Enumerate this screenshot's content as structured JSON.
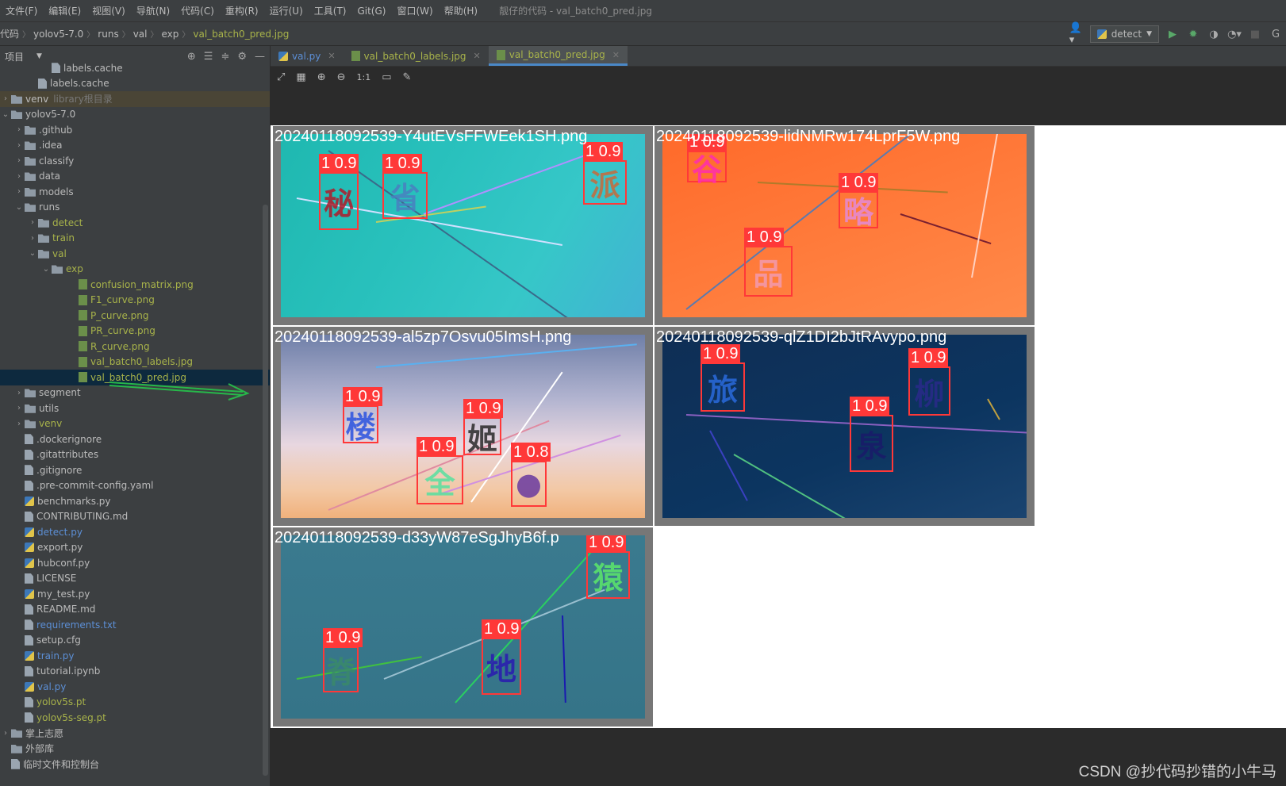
{
  "menu": {
    "items": [
      "文件(F)",
      "编辑(E)",
      "视图(V)",
      "导航(N)",
      "代码(C)",
      "重构(R)",
      "运行(U)",
      "工具(T)",
      "Git(G)",
      "窗口(W)",
      "帮助(H)"
    ],
    "window_title": "靓仔的代码 - val_batch0_pred.jpg"
  },
  "breadcrumb": {
    "root": "代码",
    "parts": [
      "yolov5-7.0",
      "runs",
      "val",
      "exp"
    ],
    "file": "val_batch0_pred.jpg"
  },
  "run_config": {
    "label": "detect"
  },
  "sidebar": {
    "title": "项目",
    "tree": [
      {
        "label": "labels.cache",
        "indent": 3,
        "icon": "file",
        "arrow": "",
        "color": ""
      },
      {
        "label": "labels.cache",
        "indent": 2,
        "icon": "file",
        "arrow": "",
        "color": ""
      },
      {
        "label": "venv",
        "suffix": "library根目录",
        "indent": 0,
        "icon": "folder",
        "arrow": "›",
        "color": "",
        "cls": "venv-root"
      },
      {
        "label": "yolov5-7.0",
        "indent": 0,
        "icon": "folder",
        "arrow": "⌄",
        "color": ""
      },
      {
        "label": ".github",
        "indent": 1,
        "icon": "folder",
        "arrow": "›",
        "color": ""
      },
      {
        "label": ".idea",
        "indent": 1,
        "icon": "folder",
        "arrow": "›",
        "color": ""
      },
      {
        "label": "classify",
        "indent": 1,
        "icon": "folder",
        "arrow": "›",
        "color": ""
      },
      {
        "label": "data",
        "indent": 1,
        "icon": "folder",
        "arrow": "›",
        "color": ""
      },
      {
        "label": "models",
        "indent": 1,
        "icon": "folder",
        "arrow": "›",
        "color": ""
      },
      {
        "label": "runs",
        "indent": 1,
        "icon": "folder",
        "arrow": "⌄",
        "color": ""
      },
      {
        "label": "detect",
        "indent": 2,
        "icon": "folder",
        "arrow": "›",
        "color": "yellow"
      },
      {
        "label": "train",
        "indent": 2,
        "icon": "folder",
        "arrow": "›",
        "color": "yellow"
      },
      {
        "label": "val",
        "indent": 2,
        "icon": "folder",
        "arrow": "⌄",
        "color": "yellow"
      },
      {
        "label": "exp",
        "indent": 3,
        "icon": "folder",
        "arrow": "⌄",
        "color": "yellow"
      },
      {
        "label": "confusion_matrix.png",
        "indent": 5,
        "icon": "img",
        "arrow": "",
        "color": "yellow"
      },
      {
        "label": "F1_curve.png",
        "indent": 5,
        "icon": "img",
        "arrow": "",
        "color": "yellow"
      },
      {
        "label": "P_curve.png",
        "indent": 5,
        "icon": "img",
        "arrow": "",
        "color": "yellow"
      },
      {
        "label": "PR_curve.png",
        "indent": 5,
        "icon": "img",
        "arrow": "",
        "color": "yellow"
      },
      {
        "label": "R_curve.png",
        "indent": 5,
        "icon": "img",
        "arrow": "",
        "color": "yellow"
      },
      {
        "label": "val_batch0_labels.jpg",
        "indent": 5,
        "icon": "img",
        "arrow": "",
        "color": "yellow"
      },
      {
        "label": "val_batch0_pred.jpg",
        "indent": 5,
        "icon": "img",
        "arrow": "",
        "color": "yellow",
        "cls": "sel"
      },
      {
        "label": "segment",
        "indent": 1,
        "icon": "folder",
        "arrow": "›",
        "color": ""
      },
      {
        "label": "utils",
        "indent": 1,
        "icon": "folder",
        "arrow": "›",
        "color": ""
      },
      {
        "label": "venv",
        "indent": 1,
        "icon": "folder",
        "arrow": "›",
        "color": "yellow"
      },
      {
        "label": ".dockerignore",
        "indent": 1,
        "icon": "file",
        "arrow": "",
        "color": ""
      },
      {
        "label": ".gitattributes",
        "indent": 1,
        "icon": "file",
        "arrow": "",
        "color": ""
      },
      {
        "label": ".gitignore",
        "indent": 1,
        "icon": "file",
        "arrow": "",
        "color": ""
      },
      {
        "label": ".pre-commit-config.yaml",
        "indent": 1,
        "icon": "file",
        "arrow": "",
        "color": ""
      },
      {
        "label": "benchmarks.py",
        "indent": 1,
        "icon": "py",
        "arrow": "",
        "color": ""
      },
      {
        "label": "CONTRIBUTING.md",
        "indent": 1,
        "icon": "file",
        "arrow": "",
        "color": ""
      },
      {
        "label": "detect.py",
        "indent": 1,
        "icon": "py",
        "arrow": "",
        "color": "blue"
      },
      {
        "label": "export.py",
        "indent": 1,
        "icon": "py",
        "arrow": "",
        "color": ""
      },
      {
        "label": "hubconf.py",
        "indent": 1,
        "icon": "py",
        "arrow": "",
        "color": ""
      },
      {
        "label": "LICENSE",
        "indent": 1,
        "icon": "file",
        "arrow": "",
        "color": ""
      },
      {
        "label": "my_test.py",
        "indent": 1,
        "icon": "py",
        "arrow": "",
        "color": ""
      },
      {
        "label": "README.md",
        "indent": 1,
        "icon": "file",
        "arrow": "",
        "color": ""
      },
      {
        "label": "requirements.txt",
        "indent": 1,
        "icon": "file",
        "arrow": "",
        "color": "blue"
      },
      {
        "label": "setup.cfg",
        "indent": 1,
        "icon": "file",
        "arrow": "",
        "color": ""
      },
      {
        "label": "train.py",
        "indent": 1,
        "icon": "py",
        "arrow": "",
        "color": "blue"
      },
      {
        "label": "tutorial.ipynb",
        "indent": 1,
        "icon": "file",
        "arrow": "",
        "color": ""
      },
      {
        "label": "val.py",
        "indent": 1,
        "icon": "py",
        "arrow": "",
        "color": "blue"
      },
      {
        "label": "yolov5s.pt",
        "indent": 1,
        "icon": "file",
        "arrow": "",
        "color": "yellow"
      },
      {
        "label": "yolov5s-seg.pt",
        "indent": 1,
        "icon": "file",
        "arrow": "",
        "color": "yellow"
      },
      {
        "label": "掌上志愿",
        "indent": 0,
        "icon": "folder",
        "arrow": "›",
        "color": ""
      },
      {
        "label": "外部库",
        "indent": 0,
        "icon": "folder",
        "arrow": "",
        "color": ""
      },
      {
        "label": "临时文件和控制台",
        "indent": 0,
        "icon": "file",
        "arrow": "",
        "color": ""
      }
    ]
  },
  "tabs": [
    {
      "label": "val.py",
      "kind": "py"
    },
    {
      "label": "val_batch0_labels.jpg",
      "kind": "img"
    },
    {
      "label": "val_batch0_pred.jpg",
      "kind": "img",
      "active": true
    }
  ],
  "image_toolbar": {
    "icons": [
      "fit-icon",
      "grid-icon",
      "zoom-in-icon",
      "zoom-out-icon",
      "actual-size-icon",
      "background-icon",
      "eyedropper-icon"
    ],
    "actual_size_label": "1:1"
  },
  "tiles": [
    {
      "name": "20240118092539-Y4utEVsFFWEek1SH.png",
      "bg": "linear-gradient(120deg,#1fb8b0 0%,#29c1bd 40%,#36c7c8 70%,#42b3d3 100%)",
      "boxes": [
        {
          "label": "1 0.9",
          "glyph": "秘",
          "glyphColor": "#b01a2a"
        },
        {
          "label": "1 0.9",
          "glyph": "省",
          "glyphColor": "#4a80c0"
        },
        {
          "label": "1 0.9",
          "glyph": "派",
          "glyphColor": "#c86a3a"
        }
      ]
    },
    {
      "name": "20240118092539-lidNMRw174LprF5W.png",
      "bg": "linear-gradient(160deg,#ff6a2a 0%,#ff7a3a 50%,#ff8a4a 100%)",
      "boxes": [
        {
          "label": "1 0.9",
          "glyph": "谷",
          "glyphColor": "#ff2db0"
        },
        {
          "label": "1 0.9",
          "glyph": "略",
          "glyphColor": "#e58ad8"
        },
        {
          "label": "1 0.9",
          "glyph": "品",
          "glyphColor": "#f39ab0"
        }
      ]
    },
    {
      "name": "20240118092539-al5zp7Osvu05ImsH.png",
      "bg": "linear-gradient(180deg,#6f7fa8 0%,#b2b4d0 35%,#e8d7e0 60%,#f3c8a4 85%,#f0b17c 100%)",
      "boxes": [
        {
          "label": "1 0.9",
          "glyph": "楼",
          "glyphColor": "#2a52e0"
        },
        {
          "label": "1 0.9",
          "glyph": "姬",
          "glyphColor": "#2a2a2a"
        },
        {
          "label": "1 0.9",
          "glyph": "全",
          "glyphColor": "#58e0a0"
        },
        {
          "label": "1 0.8",
          "glyph": "●",
          "glyphColor": "#6a3aa0"
        }
      ]
    },
    {
      "name": "20240118092539-qlZ1DI2bJtRAvypo.png",
      "bg": "linear-gradient(160deg,#0f2e55 0%,#0c3560 60%,#1a4470 100%)",
      "boxes": [
        {
          "label": "1 0.9",
          "glyph": "旅",
          "glyphColor": "#2a6adc"
        },
        {
          "label": "1 0.9",
          "glyph": "柳",
          "glyphColor": "#2a2a8a"
        },
        {
          "label": "1 0.9",
          "glyph": "泉",
          "glyphColor": "#1a1a6a"
        }
      ]
    },
    {
      "name": "20240118092539-d33yW87eSgJhyB6f.p",
      "bg": "linear-gradient(180deg,#3a7a8f 0%,#357488 100%)",
      "boxes": [
        {
          "label": "1 0.9",
          "glyph": "猿",
          "glyphColor": "#5ce86a"
        },
        {
          "label": "1 0.9",
          "glyph": "脊",
          "glyphColor": "#3a8a6a"
        },
        {
          "label": "1 0.9",
          "glyph": "地",
          "glyphColor": "#2a1ab0"
        }
      ]
    }
  ],
  "watermark": "CSDN @抄代码抄错的小牛马"
}
